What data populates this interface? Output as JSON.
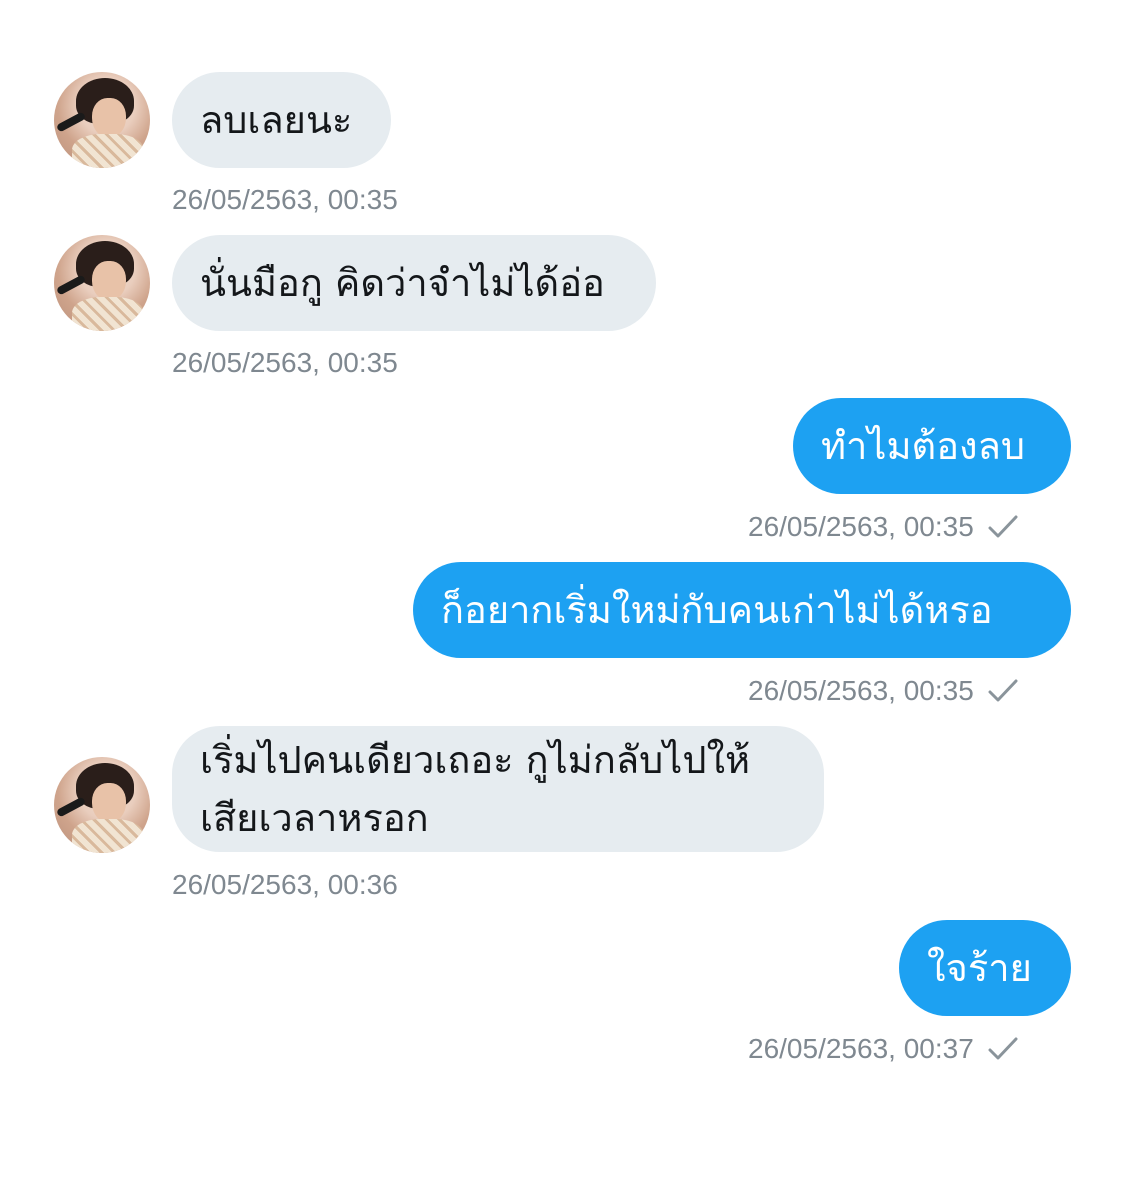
{
  "messages": [
    {
      "side": "in",
      "text": "ลบเลยนะ",
      "time": "26/05/2563, 00:35"
    },
    {
      "side": "in",
      "text": "นั่นมือกู คิดว่าจำไม่ได้อ่อ",
      "time": "26/05/2563, 00:35"
    },
    {
      "side": "out",
      "text": "ทำไมต้องลบ",
      "time": "26/05/2563, 00:35",
      "status_icon": "check-icon"
    },
    {
      "side": "out",
      "text": "ก็อยากเริ่มใหม่กับคนเก่าไม่ได้หรอ",
      "time": "26/05/2563, 00:35",
      "status_icon": "check-icon"
    },
    {
      "side": "in",
      "lines": [
        "เริ่มไปคนเดียวเถอะ กูไม่กลับไปให้",
        "เสียเวลาหรอก"
      ],
      "time": "26/05/2563, 00:36"
    },
    {
      "side": "out",
      "text": "ใจร้าย",
      "time": "26/05/2563, 00:37",
      "status_icon": "check-icon"
    }
  ],
  "colors": {
    "outgoing_bubble": "#1da1f2",
    "incoming_bubble": "#e6ecf0",
    "timestamp": "#7f8890"
  }
}
